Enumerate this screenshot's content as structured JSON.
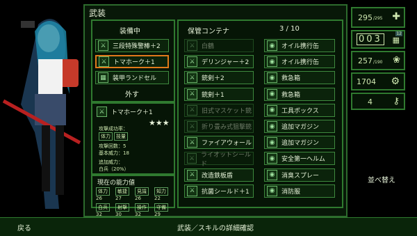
{
  "screen_title": "武装",
  "equipped": {
    "title": "装備中",
    "items": [
      "三段特殊警棒＋2",
      "トマホーク＋1",
      "装甲ランドセル"
    ],
    "remove_label": "外す"
  },
  "detail": {
    "name": "トマホーク＋1",
    "stars": "★★★",
    "attack_effect_label": "攻撃成功率：",
    "tags": [
      "体力",
      "技量"
    ],
    "attack_count": "攻撃回数：5",
    "base_power": "基本威力：18",
    "extra_power_label": "追加威力：",
    "extra_power_value": "白兵（20%）"
  },
  "abilities": {
    "title": "現在の能力値",
    "rows": [
      [
        "体力",
        "26"
      ],
      [
        "敏捷",
        "27"
      ],
      [
        "見識",
        "26"
      ],
      [
        "知力",
        "22"
      ],
      [
        "白兵",
        "32"
      ],
      [
        "射撃",
        "30"
      ],
      [
        "操作",
        "32"
      ],
      [
        "守備",
        "29"
      ]
    ]
  },
  "storage": {
    "title": "保管コンテナ",
    "count": "3 / 10",
    "left": [
      {
        "label": "白鶴",
        "disabled": true
      },
      {
        "label": "デリンジャー＋2",
        "disabled": false
      },
      {
        "label": "銃剣＋2",
        "disabled": false
      },
      {
        "label": "銃剣＋1",
        "disabled": false
      },
      {
        "label": "旧式マスケット銃",
        "disabled": true
      },
      {
        "label": "折り畳み式狙撃銃",
        "disabled": true
      },
      {
        "label": "ファイアウォール",
        "disabled": false
      },
      {
        "label": "ライオットシールド",
        "disabled": true
      },
      {
        "label": "改造鉄板盾",
        "disabled": false
      },
      {
        "label": "抗菌シールド＋1",
        "disabled": false
      }
    ],
    "right": [
      "オイル携行缶",
      "オイル携行缶",
      "救急箱",
      "救急箱",
      "工具ボックス",
      "追加マガジン",
      "追加マガジン",
      "安全第一ヘルム",
      "消臭スプレー",
      "消防服"
    ]
  },
  "stats": {
    "hp": "295",
    "hp_max": "/295",
    "counter": "003",
    "counter_badge": "12",
    "food": "257",
    "food_max": "/190",
    "gear": "1704",
    "keys": "4",
    "sort_label": "並べ替え"
  },
  "footer": {
    "back": "戻る",
    "hint": "武装／スキルの詳細確認"
  },
  "colors": {
    "accent": "#2f7a2f",
    "select": "#e07a1a",
    "bg": "#061506"
  }
}
